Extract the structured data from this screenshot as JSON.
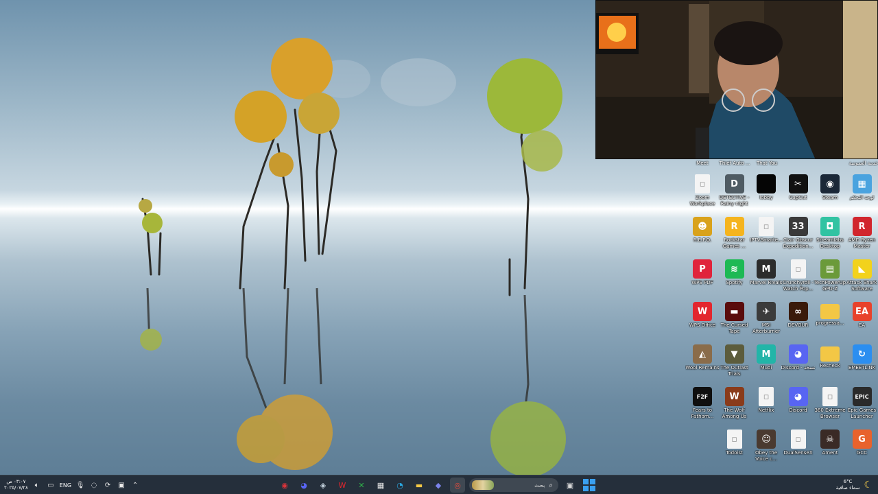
{
  "desktop": {
    "top_labels": [
      "Meet",
      "Thief Auto ...",
      "That You",
      "",
      "",
      "خدمة العمومية"
    ],
    "icons": [
      {
        "label": "Zoom Workplace",
        "icon": "zoom-file-icon",
        "color": "#f4f4f4",
        "glyph": "▫"
      },
      {
        "label": "DETECTIVE - Rainy night",
        "icon": "detective-game-icon",
        "color": "#4f5b63",
        "glyph": "D"
      },
      {
        "label": "lobby",
        "icon": "black-app-icon",
        "color": "#050505",
        "glyph": ""
      },
      {
        "label": "CapCut",
        "icon": "capcut-icon",
        "color": "#111111",
        "glyph": "✂"
      },
      {
        "label": "Steam",
        "icon": "steam-icon",
        "color": "#1b2838",
        "glyph": "◉"
      },
      {
        "label": "لوحة التحكم",
        "icon": "control-panel-icon",
        "color": "#4aa3df",
        "glyph": "▦"
      },
      {
        "label": "R.E.P.O.",
        "icon": "repo-game-icon",
        "color": "#d9a21b",
        "glyph": "☻"
      },
      {
        "label": "Rockstar Games ...",
        "icon": "rockstar-icon",
        "color": "#f5b41e",
        "glyph": "R"
      },
      {
        "label": "IPTVSmarte...",
        "icon": "blank-file-icon",
        "color": "#f4f4f4",
        "glyph": "▫"
      },
      {
        "label": "Clair Obscur Expedition...",
        "icon": "clair-obscur-icon",
        "color": "#3a3a3a",
        "glyph": "33"
      },
      {
        "label": "Streamlabs Desktop",
        "icon": "streamlabs-icon",
        "color": "#31c3a2",
        "glyph": "◘"
      },
      {
        "label": "AMD Ryzen Master",
        "icon": "amd-ryzen-icon",
        "color": "#d1262d",
        "glyph": "R"
      },
      {
        "label": "WPS PDF",
        "icon": "wps-pdf-icon",
        "color": "#e0233b",
        "glyph": "P"
      },
      {
        "label": "Spotify",
        "icon": "spotify-icon",
        "color": "#1db954",
        "glyph": "≋"
      },
      {
        "label": "Marvel Rivals",
        "icon": "marvel-rivals-icon",
        "color": "#2c2c2c",
        "glyph": "M"
      },
      {
        "label": "Crunchyroll - Watch Pop...",
        "icon": "crunchyroll-file-icon",
        "color": "#f4f4f4",
        "glyph": "▫"
      },
      {
        "label": "TechPowerUp GPU-Z",
        "icon": "gpuz-icon",
        "color": "#6b9a3a",
        "glyph": "▤"
      },
      {
        "label": "Attack Shark Software",
        "icon": "attack-shark-icon",
        "color": "#f2d21c",
        "glyph": "◣"
      },
      {
        "label": "WPS Office",
        "icon": "wps-office-icon",
        "color": "#e3262e",
        "glyph": "W"
      },
      {
        "label": "The Cursed Tape",
        "icon": "cursed-tape-icon",
        "color": "#5a0c0c",
        "glyph": "▬"
      },
      {
        "label": "MSI Afterburner",
        "icon": "msi-afterburner-icon",
        "color": "#3b3b3b",
        "glyph": "✈"
      },
      {
        "label": "DEVOUR",
        "icon": "devour-icon",
        "color": "#3a1a0a",
        "glyph": "∞"
      },
      {
        "label": "progressa...",
        "icon": "folder-icon",
        "color": "#f3c745",
        "glyph": ""
      },
      {
        "label": "EA",
        "icon": "ea-icon",
        "color": "#e8422b",
        "glyph": "EA"
      },
      {
        "label": "Wool Remains",
        "icon": "wool-remains-icon",
        "color": "#8a6c4a",
        "glyph": "◭"
      },
      {
        "label": "The Outlast Trials",
        "icon": "outlast-trials-icon",
        "color": "#5c5c3c",
        "glyph": "▼"
      },
      {
        "label": "Mudi",
        "icon": "mudi-icon",
        "color": "#22b5a8",
        "glyph": "M"
      },
      {
        "label": "Discord - نسخة",
        "icon": "discord-copy-icon",
        "color": "#5865f2",
        "glyph": "◕"
      },
      {
        "label": "Recheck",
        "icon": "folder-icon",
        "color": "#f3c745",
        "glyph": ""
      },
      {
        "label": "EMEETLINK",
        "icon": "emeetlink-icon",
        "color": "#2b8ef0",
        "glyph": "↻"
      },
      {
        "label": "Fears to Fathom...",
        "icon": "fears-to-fathom-icon",
        "color": "#0f0f0f",
        "glyph": "F2F"
      },
      {
        "label": "The Wolf Among Us",
        "icon": "wolf-among-us-icon",
        "color": "#8a3b1a",
        "glyph": "W"
      },
      {
        "label": "Netflix",
        "icon": "netflix-file-icon",
        "color": "#f4f4f4",
        "glyph": "▫"
      },
      {
        "label": "Discord",
        "icon": "discord-icon",
        "color": "#5865f2",
        "glyph": "◕"
      },
      {
        "label": "360 Extreme Browser",
        "icon": "browser-file-icon",
        "color": "#f4f4f4",
        "glyph": "▫"
      },
      {
        "label": "Epic Games Launcher",
        "icon": "epic-games-icon",
        "color": "#2a2a2a",
        "glyph": "EPIC"
      },
      {
        "label": "Todoist",
        "icon": "todoist-file-icon",
        "color": "#f4f4f4",
        "glyph": "▫"
      },
      {
        "label": "Obey the Voice c...",
        "icon": "obey-voice-icon",
        "color": "#4a3a30",
        "glyph": "☺"
      },
      {
        "label": "DualSenseX",
        "icon": "dualsensex-icon",
        "color": "#f4f4f4",
        "glyph": "▫"
      },
      {
        "label": "Ament",
        "icon": "ament-icon",
        "color": "#3a2a26",
        "glyph": "☠"
      },
      {
        "label": "GCC",
        "icon": "gcc-icon",
        "color": "#e8622c",
        "glyph": "G"
      }
    ]
  },
  "taskbar": {
    "clock_time": "٠٣:٠٧ ص",
    "clock_date": "٢٠٢٥/٠٧/٢٨",
    "language": "ENG",
    "search_placeholder": "بحث",
    "weather_temp": "6°C",
    "weather_desc": "سماء صافية",
    "tray_icons": [
      "volume-icon",
      "network-icon",
      "vpn-icon",
      "refresh-icon",
      "app-tray-icon",
      "chevron-up-icon"
    ],
    "apps": [
      {
        "name": "obs-app-icon",
        "glyph": "◉",
        "color": "#d9333a"
      },
      {
        "name": "discord-app-icon",
        "glyph": "◕",
        "color": "#5865f2"
      },
      {
        "name": "steam-app-icon",
        "glyph": "◈",
        "color": "#c7d5e0"
      },
      {
        "name": "wps-app-icon",
        "glyph": "W",
        "color": "#e3262e"
      },
      {
        "name": "xbox-app-icon",
        "glyph": "✕",
        "color": "#2fb34a"
      },
      {
        "name": "store-app-icon",
        "glyph": "▦",
        "color": "#e8e8e8"
      },
      {
        "name": "edge-app-icon",
        "glyph": "◔",
        "color": "#2aa7e0"
      },
      {
        "name": "file-explorer-app-icon",
        "glyph": "▬",
        "color": "#f3c745"
      },
      {
        "name": "teams-app-icon",
        "glyph": "◆",
        "color": "#7b83eb"
      },
      {
        "name": "chrome-app-icon",
        "glyph": "◎",
        "color": "#e64a3b"
      },
      {
        "name": "task-view-icon",
        "glyph": "▣",
        "color": "#d8d8d8"
      }
    ]
  }
}
